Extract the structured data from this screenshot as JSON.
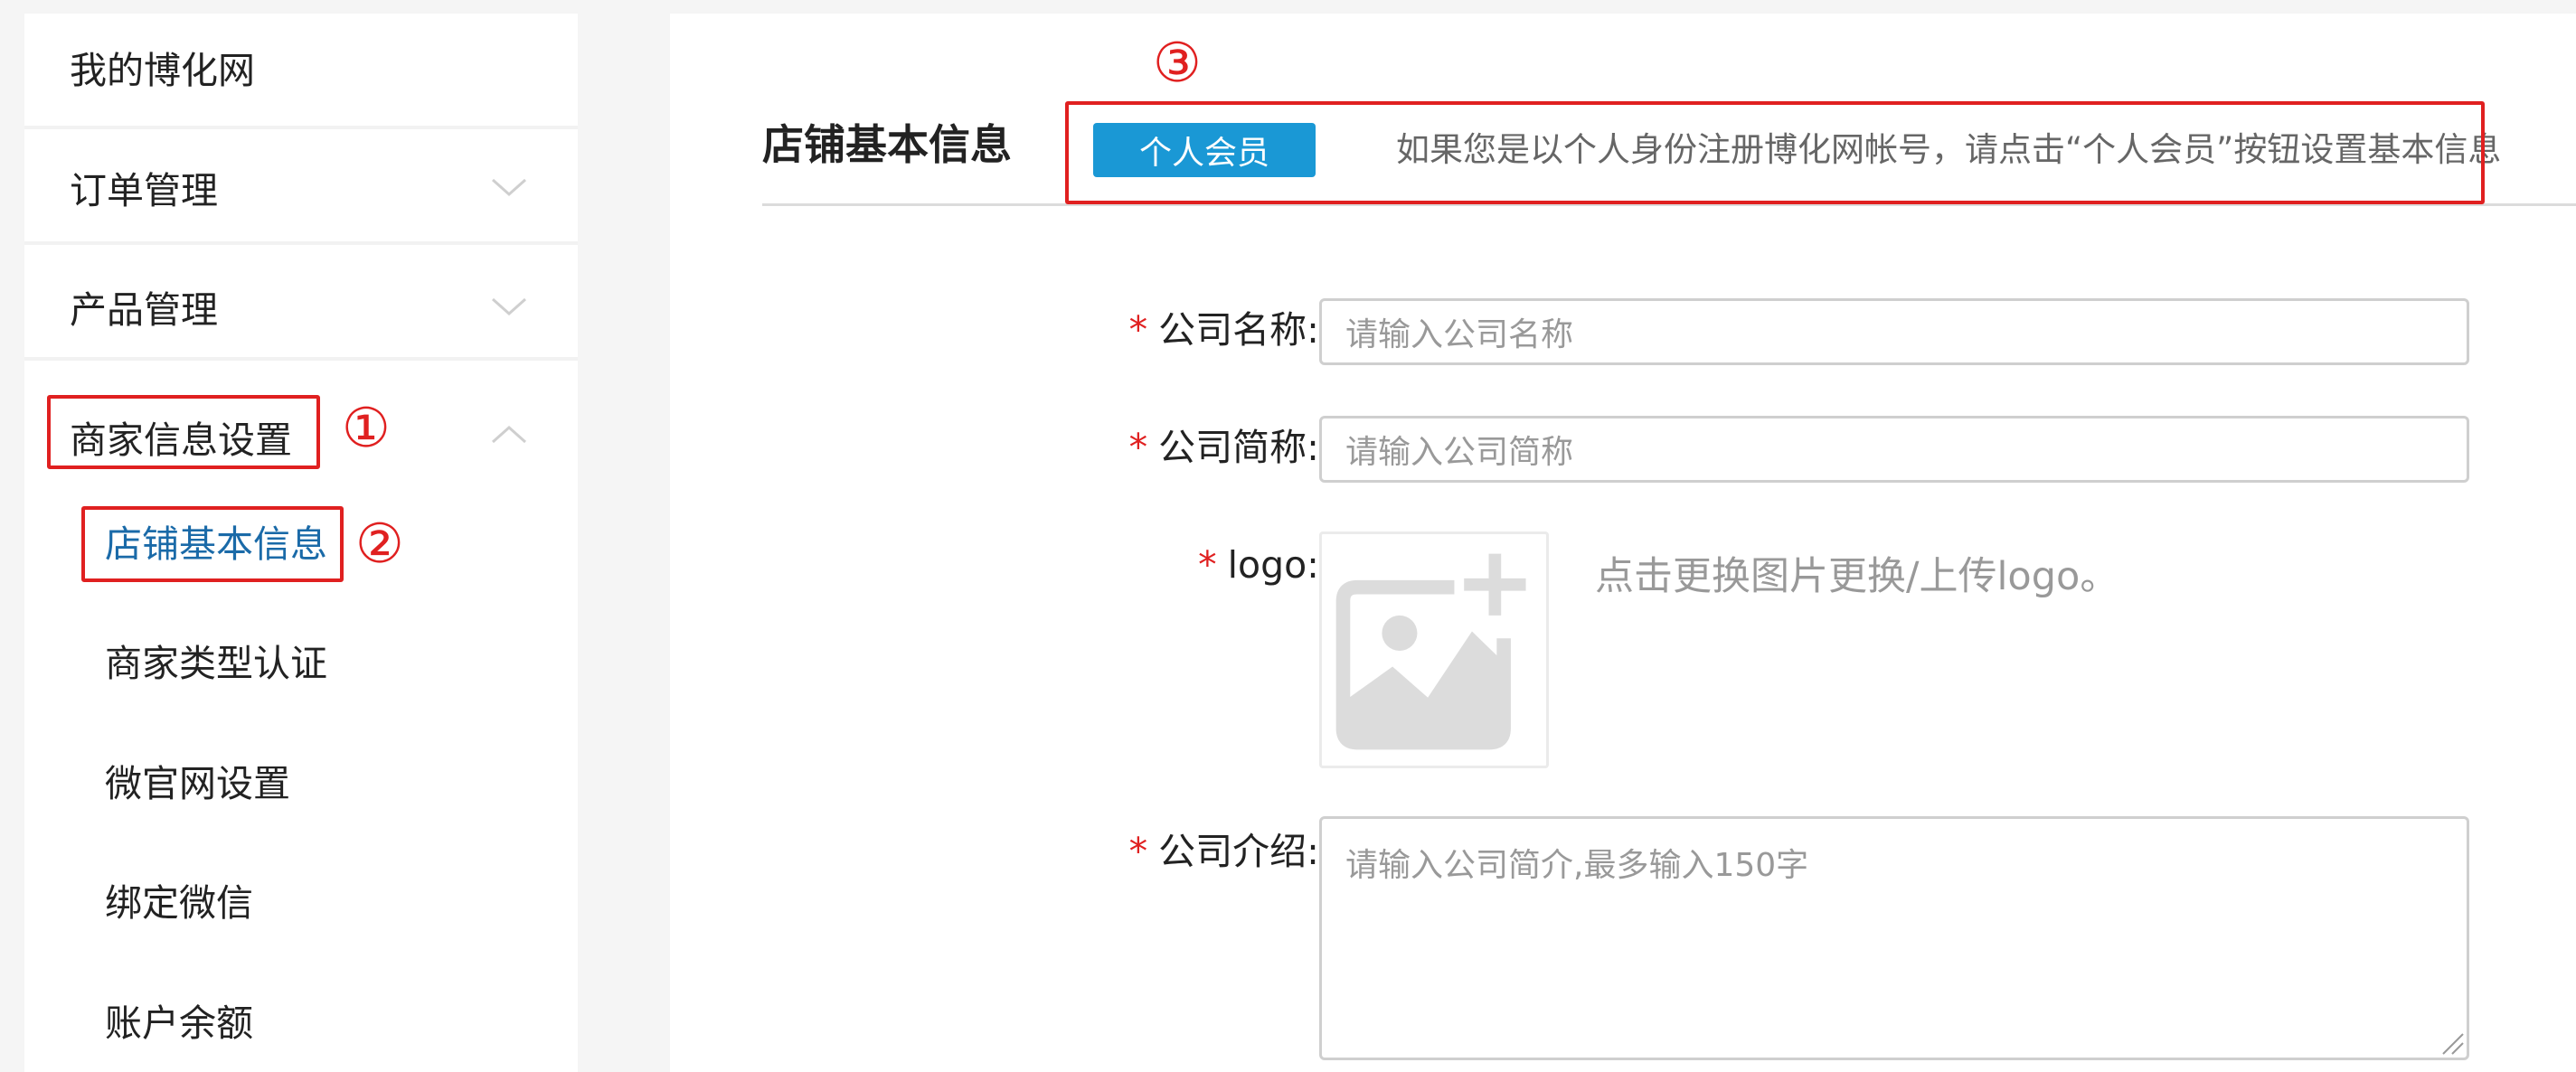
{
  "sidebar": {
    "top_item": "我的博化网",
    "order_mgmt": "订单管理",
    "product_mgmt": "产品管理",
    "merchant_info": "商家信息设置",
    "sub_items": [
      "店铺基本信息",
      "商家类型认证",
      "微官网设置",
      "绑定微信",
      "账户余额"
    ]
  },
  "annotations": {
    "one": "①",
    "two": "②",
    "three": "③"
  },
  "main": {
    "title": "店铺基本信息",
    "member_button": "个人会员",
    "hint": "如果您是以个人身份注册博化网帐号，请点击“个人会员”按钮设置基本信息",
    "required_mark": "*",
    "fields": {
      "company_name_label": "公司名称:",
      "company_name_placeholder": "请输入公司名称",
      "company_short_label": "公司简称:",
      "company_short_placeholder": "请输入公司简称",
      "logo_label": "logo:",
      "logo_hint": "点击更换图片更换/上传logo。",
      "intro_label": "公司介绍:",
      "intro_placeholder": "请输入公司简介,最多输入150字"
    }
  },
  "icons": [
    "chevron-down-icon",
    "chevron-up-icon",
    "image-upload-icon"
  ],
  "colors": {
    "accent": "#1a98d5",
    "annotation": "#e02020",
    "active_link": "#1a6aa8"
  }
}
